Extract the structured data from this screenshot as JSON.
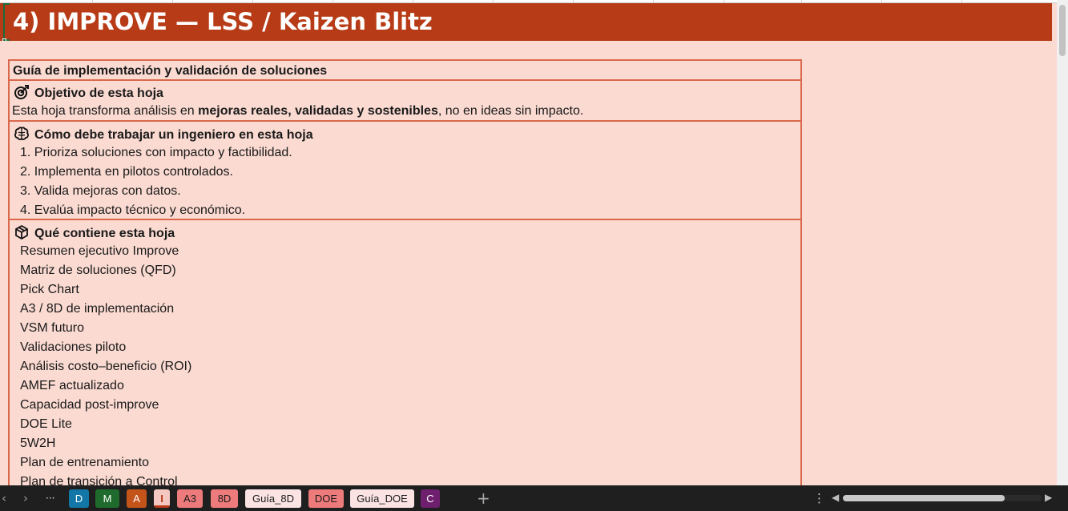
{
  "sheet": {
    "title": "4) IMPROVE — LSS / Kaizen Blitz"
  },
  "guide": {
    "header": "Guía de implementación y validación de soluciones",
    "objective": {
      "icon": "target-icon",
      "heading": "Objetivo de esta hoja",
      "text_before": "Esta hoja transforma análisis en ",
      "text_bold": "mejoras reales, validadas y sostenibles",
      "text_after": ", no en ideas sin impacto."
    },
    "how": {
      "icon": "brain-icon",
      "heading": "Cómo debe trabajar un ingeniero en esta hoja",
      "steps": [
        "1. Prioriza soluciones con impacto y factibilidad.",
        "2. Implementa en pilotos controlados.",
        "3. Valida mejoras con datos.",
        "4. Evalúa impacto técnico y económico."
      ]
    },
    "contents": {
      "icon": "package-icon",
      "heading": "Qué contiene esta hoja",
      "items": [
        "Resumen ejecutivo Improve",
        "Matriz de soluciones (QFD)",
        "Pick Chart",
        "A3 / 8D de implementación",
        "VSM futuro",
        "Validaciones piloto",
        "Análisis costo–beneficio (ROI)",
        "AMEF actualizado",
        "Capacidad post-improve",
        "DOE Lite",
        "5W2H",
        "Plan de entrenamiento",
        "Plan de transición a Control"
      ]
    }
  },
  "tabs": [
    {
      "label": "D",
      "bg": "#1276a6",
      "fg": "#ffffff"
    },
    {
      "label": "M",
      "bg": "#1e6b2d",
      "fg": "#ffffff"
    },
    {
      "label": "A",
      "bg": "#c4541a",
      "fg": "#ffffff"
    },
    {
      "label": "I",
      "bg": "#f4c7c0",
      "fg": "#b73b16",
      "active": true
    },
    {
      "label": "A3",
      "bg": "#ee7b7b",
      "fg": "#1a1a1a"
    },
    {
      "label": "8D",
      "bg": "#ee7b7b",
      "fg": "#1a1a1a"
    },
    {
      "label": "Guía_8D",
      "bg": "#fbe3e3",
      "fg": "#1a1a1a"
    },
    {
      "label": "DOE",
      "bg": "#ee7b7b",
      "fg": "#1a1a1a"
    },
    {
      "label": "Guía_DOE",
      "bg": "#fbe3e3",
      "fg": "#1a1a1a"
    },
    {
      "label": "C",
      "bg": "#6e1f6e",
      "fg": "#ffffff"
    }
  ],
  "nav": {
    "prev": "‹",
    "next": "›",
    "more": "···",
    "add": "+",
    "options": "⋮"
  }
}
